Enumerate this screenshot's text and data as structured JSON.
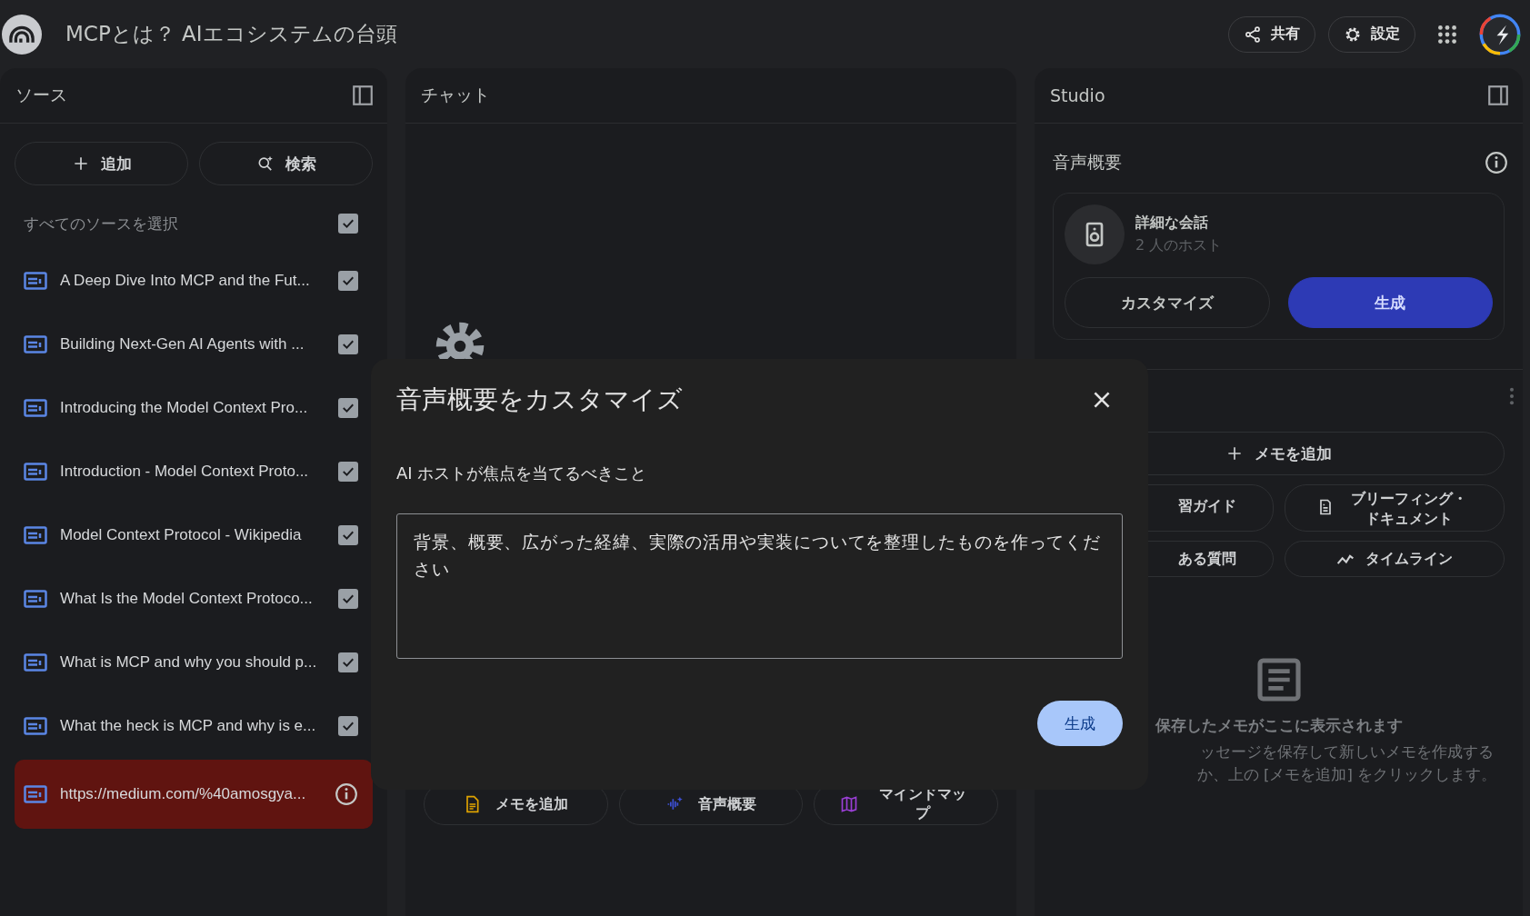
{
  "header": {
    "title": "MCPとは？ AIエコシステムの台頭",
    "buttons": [
      {
        "label": "共有",
        "kind": "share"
      },
      {
        "label": "設定",
        "kind": "settings"
      }
    ]
  },
  "sources": {
    "title": "ソース",
    "buttons": [
      {
        "label": "追加",
        "kind": "add"
      },
      {
        "label": "検索",
        "kind": "search"
      }
    ],
    "select_all": {
      "label": "すべてのソースを選択",
      "checked": true
    },
    "items": [
      {
        "title": "A Deep Dive Into MCP and the Fut...",
        "kind": "source",
        "checked": true
      },
      {
        "title": "Building Next-Gen AI Agents with ...",
        "kind": "source",
        "checked": true
      },
      {
        "title": "Introducing the Model Context Pro...",
        "kind": "source",
        "checked": true
      },
      {
        "title": "Introduction - Model Context Proto...",
        "kind": "source",
        "checked": true
      },
      {
        "title": "Model Context Protocol - Wikipedia",
        "kind": "source",
        "checked": true
      },
      {
        "title": "What Is the Model Context Protoco...",
        "kind": "source",
        "checked": true
      },
      {
        "title": "What is MCP and why you should p...",
        "kind": "source",
        "checked": true
      },
      {
        "title": "What the heck is MCP and why is e...",
        "kind": "source",
        "checked": true
      },
      {
        "title": "https://medium.com/%40amosgya...",
        "kind": "failed"
      }
    ]
  },
  "chat": {
    "title": "チャット",
    "actions": [
      {
        "label": "メモを追加",
        "kind": "note"
      },
      {
        "label": "音声概要",
        "kind": "audio"
      },
      {
        "label": "マインドマップ",
        "kind": "mindmap"
      }
    ]
  },
  "studio": {
    "title": "Studio",
    "audio_heading": "音声概要",
    "card": {
      "title": "詳細な会話",
      "subtitle": "2 人のホスト",
      "buttons": [
        {
          "label": "カスタマイズ",
          "primary": false
        },
        {
          "label": "生成",
          "primary": true
        }
      ]
    },
    "add_note": "メモを追加",
    "actions": [
      {
        "label": "習ガイド",
        "kind": "text"
      },
      {
        "label": "ブリーフィング・ドキュメント",
        "kind": "doc"
      },
      {
        "label": "ある質問",
        "kind": "text"
      },
      {
        "label": "タイムライン",
        "kind": "timeline"
      }
    ],
    "empty_title": "保存したメモがここに表示されます",
    "empty_text": "ッセージを保存して新しいメモを作成するか、上の [メモを追加] をクリックします。"
  },
  "dialog": {
    "title": "音声概要をカスタマイズ",
    "label": "AI ホストが焦点を当てるべきこと",
    "value": "背景、概要、広がった経緯、実際の活用や実装についてを整理したものを作ってください",
    "button": "生成"
  }
}
